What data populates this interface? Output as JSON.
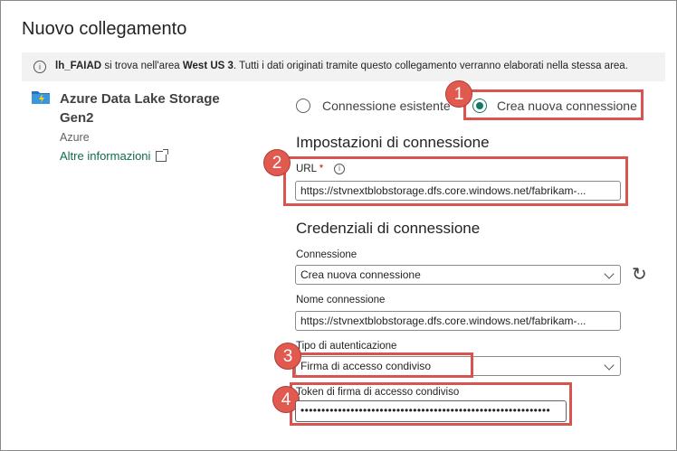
{
  "dialog": {
    "title": "Nuovo collegamento"
  },
  "info": {
    "lakehouse": "lh_FAIAD",
    "text1": " si trova nell'area ",
    "region": "West US 3",
    "text2": ". Tutti i dati originati tramite questo collegamento verranno elaborati nella stessa area."
  },
  "source": {
    "name": "Azure Data Lake Storage Gen2",
    "provider": "Azure",
    "link": "Altre informazioni"
  },
  "connection_mode": {
    "existing": "Connessione esistente",
    "new": "Crea nuova connessione",
    "selected": "new"
  },
  "settings": {
    "heading": "Impostazioni di connessione",
    "url_label": "URL",
    "required_mark": "*",
    "url_value": "https://stvnextblobstorage.dfs.core.windows.net/fabrikam-..."
  },
  "credentials": {
    "heading": "Credenziali di connessione",
    "connection_label": "Connessione",
    "connection_value": "Crea nuova connessione",
    "name_label": "Nome connessione",
    "name_value": "https://stvnextblobstorage.dfs.core.windows.net/fabrikam-...",
    "auth_label": "Tipo di autenticazione",
    "auth_value": "Firma di accesso condiviso",
    "token_label": "Token di firma di accesso condiviso",
    "token_value": "••••••••••••••••••••••••••••••••••••••••••••••••••••••••••••"
  },
  "badges": [
    "1",
    "2",
    "3",
    "4"
  ],
  "colors": {
    "accent": "#117865",
    "highlight": "#d9534f",
    "badge": "#e05a4f",
    "link": "#0f6a52"
  },
  "icons": {
    "info": "info-icon",
    "storage": "adls-icon",
    "external": "external-link-icon",
    "refresh": "refresh-icon",
    "dropdown": "chevron-down-icon"
  }
}
